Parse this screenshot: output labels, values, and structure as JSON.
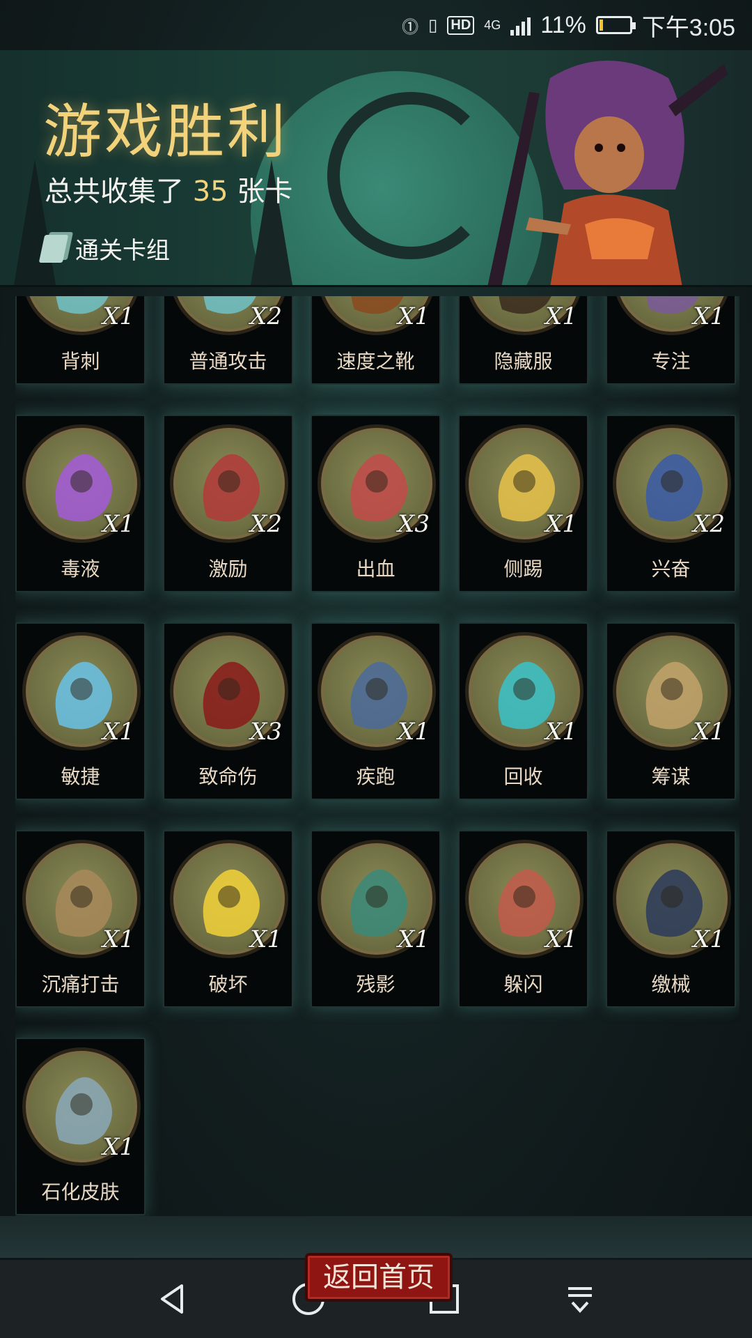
{
  "status_bar": {
    "battery_percent": "11%",
    "time": "下午3:05",
    "network": "4G",
    "hd": "HD",
    "battery_level": 0.11
  },
  "banner": {
    "title": "游戏胜利",
    "subtitle_prefix": "总共收集了",
    "total_cards": "35",
    "subtitle_suffix": "张卡",
    "deck_label": "通关卡组"
  },
  "cards": [
    {
      "name": "背刺",
      "count": "X1",
      "art": "dagger-icon",
      "color": "#6ec2c8"
    },
    {
      "name": "普通攻击",
      "count": "X2",
      "art": "axe-icon",
      "color": "#6ec2c8"
    },
    {
      "name": "速度之靴",
      "count": "X1",
      "art": "boot-icon",
      "color": "#8a4a1e"
    },
    {
      "name": "隐藏服",
      "count": "X1",
      "art": "cloak-icon",
      "color": "#3a2a1e"
    },
    {
      "name": "专注",
      "count": "X1",
      "art": "focus-icon",
      "color": "#7a5a9a"
    },
    {
      "name": "毒液",
      "count": "X1",
      "art": "venom-icon",
      "color": "#a35ad8"
    },
    {
      "name": "激励",
      "count": "X2",
      "art": "hammer-icon",
      "color": "#b23a3a"
    },
    {
      "name": "出血",
      "count": "X3",
      "art": "octopus-icon",
      "color": "#c24a4a"
    },
    {
      "name": "侧踢",
      "count": "X1",
      "art": "kick-icon",
      "color": "#e8c24a"
    },
    {
      "name": "兴奋",
      "count": "X2",
      "art": "dwarf-icon",
      "color": "#3a5aa8"
    },
    {
      "name": "敏捷",
      "count": "X1",
      "art": "panther-icon",
      "color": "#6ac2e8"
    },
    {
      "name": "致命伤",
      "count": "X3",
      "art": "blood-icon",
      "color": "#8a1a1a"
    },
    {
      "name": "疾跑",
      "count": "X1",
      "art": "wolf-icon",
      "color": "#4a6a9a"
    },
    {
      "name": "回收",
      "count": "X1",
      "art": "boomerang-icon",
      "color": "#3ac2c8"
    },
    {
      "name": "筹谋",
      "count": "X1",
      "art": "map-icon",
      "color": "#c2a26a"
    },
    {
      "name": "沉痛打击",
      "count": "X1",
      "art": "brute-icon",
      "color": "#a8885a"
    },
    {
      "name": "破坏",
      "count": "X1",
      "art": "bolt-icon",
      "color": "#f2d23a"
    },
    {
      "name": "残影",
      "count": "X1",
      "art": "shadows-icon",
      "color": "#3a8a7a"
    },
    {
      "name": "躲闪",
      "count": "X1",
      "art": "dodge-icon",
      "color": "#c25a4a"
    },
    {
      "name": "缴械",
      "count": "X1",
      "art": "shield-icon",
      "color": "#2a3a5a"
    },
    {
      "name": "石化皮肤",
      "count": "X1",
      "art": "stone-skin-icon",
      "color": "#8aa8b8"
    }
  ],
  "footer": {
    "home_button": "返回首页"
  }
}
